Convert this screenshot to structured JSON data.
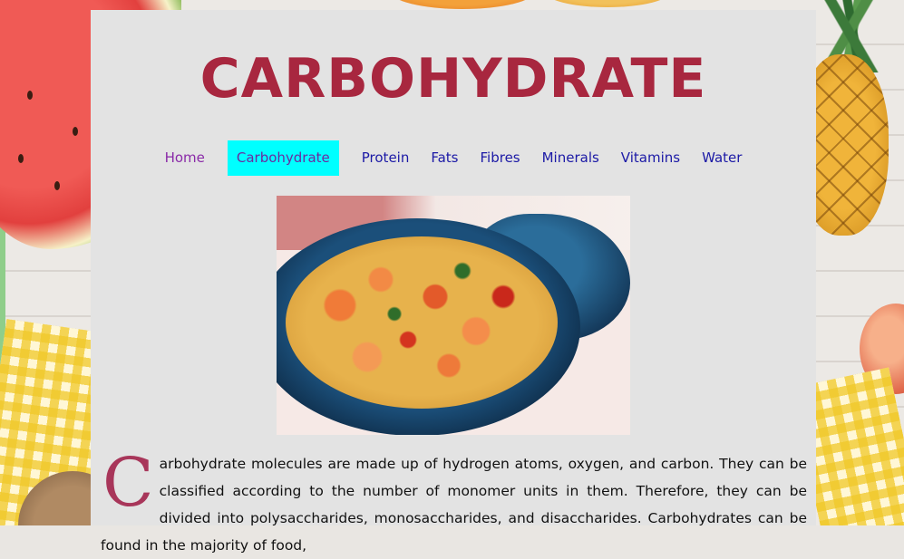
{
  "page": {
    "title": "CARBOHYDRATE"
  },
  "nav": {
    "items": [
      {
        "label": "Home",
        "state": "visited"
      },
      {
        "label": "Carbohydrate",
        "state": "active"
      },
      {
        "label": "Protein",
        "state": "normal"
      },
      {
        "label": "Fats",
        "state": "normal"
      },
      {
        "label": "Fibres",
        "state": "normal"
      },
      {
        "label": "Minerals",
        "state": "normal"
      },
      {
        "label": "Vitamins",
        "state": "normal"
      },
      {
        "label": "Water",
        "state": "normal"
      }
    ]
  },
  "content": {
    "image_subject": "paella-dish-image",
    "drop_cap": "C",
    "paragraph": "arbohydrate molecules are made up of hydrogen atoms, oxygen, and carbon. They can be classified according to the number of monomer units in them. Therefore, they can be divided into polysaccharides, monosaccharides, and disaccharides. Carbohydrates can be found in the majority of food,"
  },
  "colors": {
    "title": "#a8273f",
    "active_tab_bg": "#00ffff",
    "link": "#1c1aa6",
    "visited_link": "#8a2aa8",
    "drop_cap": "#a8365a",
    "panel_bg": "#e3e3e3"
  }
}
